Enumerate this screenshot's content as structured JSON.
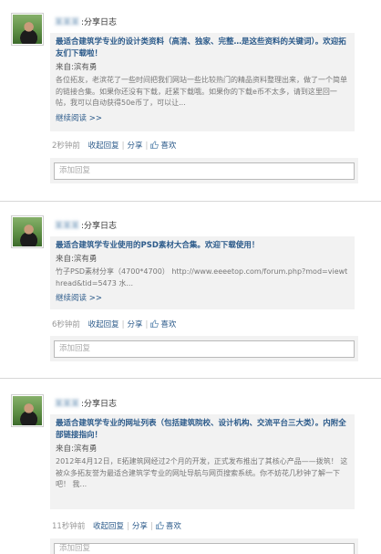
{
  "feed": [
    {
      "user_name": "某某某",
      "share_label": ":分享日志",
      "title": "最适合建筑学专业的设计类资料（高清、独家、完整…是这些资料的关键词）。欢迎拓友们下载啦！",
      "source": "来自:滨有勇",
      "summary": "各位拓友，老滨花了一些时间把我们网站一些比较热门的精品资料整理出来，做了一个简单的链接合集。如果你还没有下载，赶紧下载哦。如果你的下载e币不太多，请到这里回一帖，我可以自动获得50e币了，可以让...",
      "more": "继续阅读 >>",
      "time": "2秒钟前",
      "reply": "收起回复",
      "share": "分享",
      "like": "喜欢",
      "reply_placeholder": "添加回复"
    },
    {
      "user_name": "某某某",
      "share_label": ":分享日志",
      "title": "最适合建筑学专业使用的PSD素材大合集。欢迎下载使用！",
      "source": "来自:滨有勇",
      "summary": "竹子PSD素材分享（4700*4700） http://www.eeeetop.com/forum.php?mod=viewthread&tid=5473 水...",
      "more": "继续阅读 >>",
      "time": "6秒钟前",
      "reply": "收起回复",
      "share": "分享",
      "like": "喜欢",
      "reply_placeholder": "添加回复"
    },
    {
      "user_name": "某某某",
      "share_label": ":分享日志",
      "title": "最适合建筑学专业的网址列表（包括建筑院校、设计机构、交流平台三大类）。内附全部链接指向！",
      "source": "来自:滨有勇",
      "summary": "2012年4月12日，E拓建筑网经过2个月的开发，正式发布推出了其核心产品——拨筑！ 这被众多拓友誉为最适合建筑学专业的网址导航与网页搜索系统。你不妨花几秒钟了解一下吧！ 我...",
      "more": "",
      "time": "11秒钟前",
      "reply": "收起回复",
      "share": "分享",
      "like": "喜欢",
      "reply_placeholder": "添加回复"
    }
  ]
}
